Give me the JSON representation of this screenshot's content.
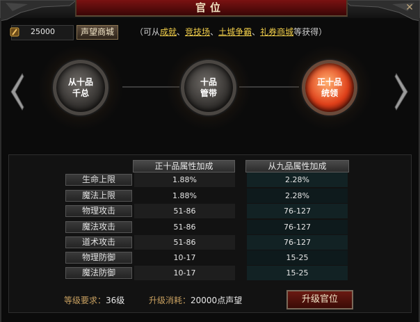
{
  "window": {
    "title": "官位",
    "close_glyph": "✕"
  },
  "currency": {
    "amount": "25000",
    "icon": "feather-coin-icon"
  },
  "shop_button": "声望商城",
  "hint": {
    "prefix": "（可从",
    "links": [
      "成就",
      "竞技场",
      "土城争霸",
      "礼券商城"
    ],
    "sep": "、",
    "suffix": "等获得）"
  },
  "ranks": [
    {
      "line1": "从十品",
      "line2": "千总",
      "active": false
    },
    {
      "line1": "十品",
      "line2": "管带",
      "active": false
    },
    {
      "line1": "正十品",
      "line2": "统领",
      "active": true
    }
  ],
  "table": {
    "headers": [
      "正十品属性加成",
      "从九品属性加成"
    ],
    "rows": [
      {
        "label": "生命上限",
        "current": "1.88%",
        "next": "2.28%"
      },
      {
        "label": "魔法上限",
        "current": "1.88%",
        "next": "2.28%"
      },
      {
        "label": "物理攻击",
        "current": "51-86",
        "next": "76-127"
      },
      {
        "label": "魔法攻击",
        "current": "51-86",
        "next": "76-127"
      },
      {
        "label": "道术攻击",
        "current": "51-86",
        "next": "76-127"
      },
      {
        "label": "物理防御",
        "current": "10-17",
        "next": "15-25"
      },
      {
        "label": "魔法防御",
        "current": "10-17",
        "next": "15-25"
      }
    ]
  },
  "footer": {
    "level_key": "等级要求：",
    "level_val": "36级",
    "cost_key": "升级消耗：",
    "cost_val": "20000点声望",
    "upgrade_button": "升级官位"
  },
  "colors": {
    "accent_red": "#7a1212",
    "link_gold": "#f2cf4a",
    "active_orb": "#e0401a"
  }
}
